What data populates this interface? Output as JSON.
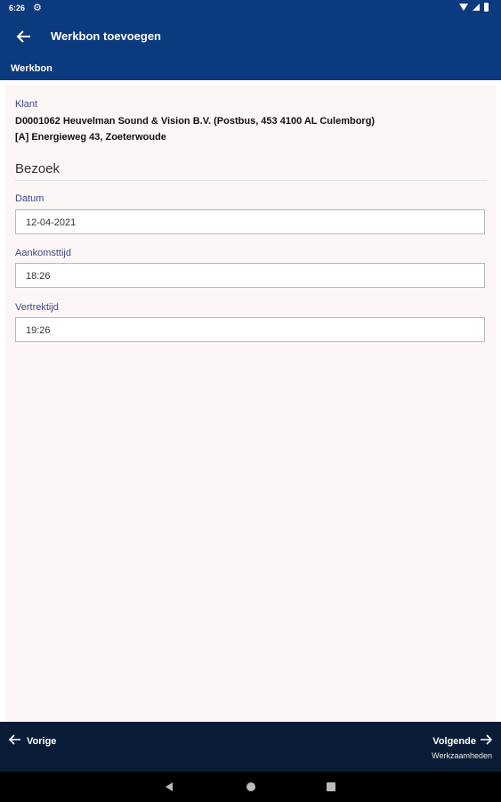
{
  "status": {
    "time": "6:26"
  },
  "appbar": {
    "title": "Werkbon toevoegen"
  },
  "section": {
    "title": "Werkbon"
  },
  "klant": {
    "label": "Klant",
    "line1": "D0001062 Heuvelman Sound & Vision B.V. (Postbus, 453 4100 AL Culemborg)",
    "line2": "[A] Energieweg 43,  Zoeterwoude"
  },
  "bezoek": {
    "heading": "Bezoek",
    "datum": {
      "label": "Datum",
      "value": "12-04-2021"
    },
    "aankomsttijd": {
      "label": "Aankomsttijd",
      "value": "18:26"
    },
    "vertrektijd": {
      "label": "Vertrektijd",
      "value": "19:26"
    }
  },
  "footer": {
    "prev_label": "Vorige",
    "next_label": "Volgende",
    "next_sub": "Werkzaamheden"
  },
  "colors": {
    "primary": "#0b3a7e",
    "footer": "#0a1c36",
    "content_bg": "#fdf6f6",
    "label": "#3b4a8a"
  },
  "icons": [
    "settings-icon",
    "wifi-icon",
    "signal-icon",
    "battery-icon",
    "arrow-back-icon",
    "arrow-left-icon",
    "arrow-right-icon",
    "nav-back-icon",
    "nav-home-icon",
    "nav-recents-icon"
  ]
}
